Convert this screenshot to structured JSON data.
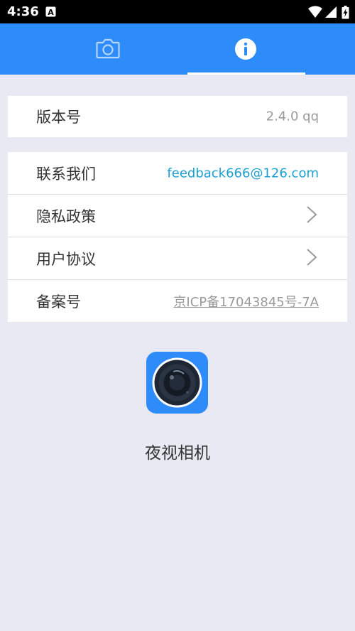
{
  "status_bar": {
    "time": "4:36",
    "notification_icon": "a-letter-icon",
    "icons": [
      "wifi-icon",
      "cellular-signal-icon",
      "battery-charging-icon"
    ]
  },
  "tabs": [
    {
      "icon": "camera-icon",
      "selected": false
    },
    {
      "icon": "info-icon",
      "selected": true
    }
  ],
  "version": {
    "label": "版本号",
    "value": "2.4.0  qq"
  },
  "list": {
    "contact": {
      "label": "联系我们",
      "value": "feedback666@126.com"
    },
    "privacy": {
      "label": "隐私政策"
    },
    "agreement": {
      "label": "用户协议"
    },
    "icp": {
      "label": "备案号",
      "value": "京ICP备17043845号-7A"
    }
  },
  "app": {
    "name": "夜视相机",
    "icon": "camera-lens-logo-icon"
  },
  "colors": {
    "primary": "#2d8cf9",
    "background": "#e9e9f3",
    "link": "#1a9fd1",
    "muted": "#9a9a9a"
  }
}
